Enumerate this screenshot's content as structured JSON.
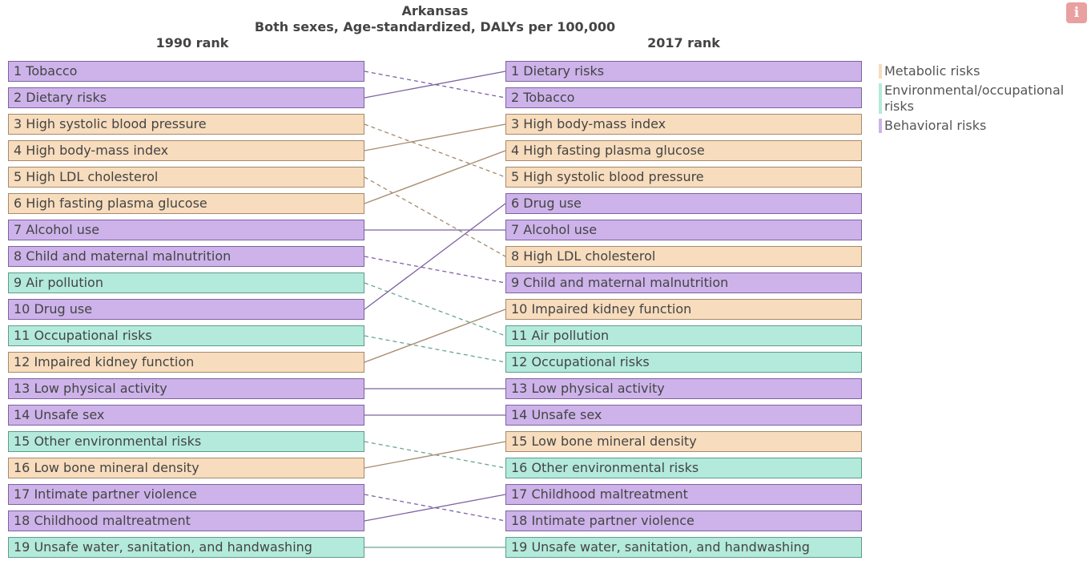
{
  "chart_data": {
    "type": "table",
    "title": "Arkansas",
    "subtitle": "Both sexes, Age-standardized, DALYs per 100,000",
    "left_header": "1990 rank",
    "right_header": "2017 rank",
    "categories": {
      "metabolic": {
        "label": "Metabolic risks",
        "fill": "#f7dcbd",
        "border": "#a68a6c",
        "line": "#a68a6c"
      },
      "environmental": {
        "label": "Environmental/occupational risks",
        "fill": "#b3eadc",
        "border": "#5e9c8a",
        "line": "#6aa594"
      },
      "behavioral": {
        "label": "Behavioral risks",
        "fill": "#cdb3ea",
        "border": "#7e62a1",
        "line": "#7e62a1"
      }
    },
    "legend_order": [
      "metabolic",
      "environmental",
      "behavioral"
    ],
    "rank_1990": [
      {
        "rank": 1,
        "name": "Tobacco",
        "category": "behavioral"
      },
      {
        "rank": 2,
        "name": "Dietary risks",
        "category": "behavioral"
      },
      {
        "rank": 3,
        "name": "High systolic blood pressure",
        "category": "metabolic"
      },
      {
        "rank": 4,
        "name": "High body-mass index",
        "category": "metabolic"
      },
      {
        "rank": 5,
        "name": "High LDL cholesterol",
        "category": "metabolic"
      },
      {
        "rank": 6,
        "name": "High fasting plasma glucose",
        "category": "metabolic"
      },
      {
        "rank": 7,
        "name": "Alcohol use",
        "category": "behavioral"
      },
      {
        "rank": 8,
        "name": "Child and maternal malnutrition",
        "category": "behavioral"
      },
      {
        "rank": 9,
        "name": "Air pollution",
        "category": "environmental"
      },
      {
        "rank": 10,
        "name": "Drug use",
        "category": "behavioral"
      },
      {
        "rank": 11,
        "name": "Occupational risks",
        "category": "environmental"
      },
      {
        "rank": 12,
        "name": "Impaired kidney function",
        "category": "metabolic"
      },
      {
        "rank": 13,
        "name": "Low physical activity",
        "category": "behavioral"
      },
      {
        "rank": 14,
        "name": "Unsafe sex",
        "category": "behavioral"
      },
      {
        "rank": 15,
        "name": "Other environmental risks",
        "category": "environmental"
      },
      {
        "rank": 16,
        "name": "Low bone mineral density",
        "category": "metabolic"
      },
      {
        "rank": 17,
        "name": "Intimate partner violence",
        "category": "behavioral"
      },
      {
        "rank": 18,
        "name": "Childhood maltreatment",
        "category": "behavioral"
      },
      {
        "rank": 19,
        "name": "Unsafe water, sanitation, and handwashing",
        "category": "environmental"
      }
    ],
    "rank_2017": [
      {
        "rank": 1,
        "name": "Dietary risks",
        "category": "behavioral"
      },
      {
        "rank": 2,
        "name": "Tobacco",
        "category": "behavioral"
      },
      {
        "rank": 3,
        "name": "High body-mass index",
        "category": "metabolic"
      },
      {
        "rank": 4,
        "name": "High fasting plasma glucose",
        "category": "metabolic"
      },
      {
        "rank": 5,
        "name": "High systolic blood pressure",
        "category": "metabolic"
      },
      {
        "rank": 6,
        "name": "Drug use",
        "category": "behavioral"
      },
      {
        "rank": 7,
        "name": "Alcohol use",
        "category": "behavioral"
      },
      {
        "rank": 8,
        "name": "High LDL cholesterol",
        "category": "metabolic"
      },
      {
        "rank": 9,
        "name": "Child and maternal malnutrition",
        "category": "behavioral"
      },
      {
        "rank": 10,
        "name": "Impaired kidney function",
        "category": "metabolic"
      },
      {
        "rank": 11,
        "name": "Air pollution",
        "category": "environmental"
      },
      {
        "rank": 12,
        "name": "Occupational risks",
        "category": "environmental"
      },
      {
        "rank": 13,
        "name": "Low physical activity",
        "category": "behavioral"
      },
      {
        "rank": 14,
        "name": "Unsafe sex",
        "category": "behavioral"
      },
      {
        "rank": 15,
        "name": "Low bone mineral density",
        "category": "metabolic"
      },
      {
        "rank": 16,
        "name": "Other environmental risks",
        "category": "environmental"
      },
      {
        "rank": 17,
        "name": "Childhood maltreatment",
        "category": "behavioral"
      },
      {
        "rank": 18,
        "name": "Intimate partner violence",
        "category": "behavioral"
      },
      {
        "rank": 19,
        "name": "Unsafe water, sanitation, and handwashing",
        "category": "environmental"
      }
    ]
  },
  "info_button": {
    "icon": "info-icon",
    "glyph": "i",
    "color": "#e8a0a0"
  }
}
